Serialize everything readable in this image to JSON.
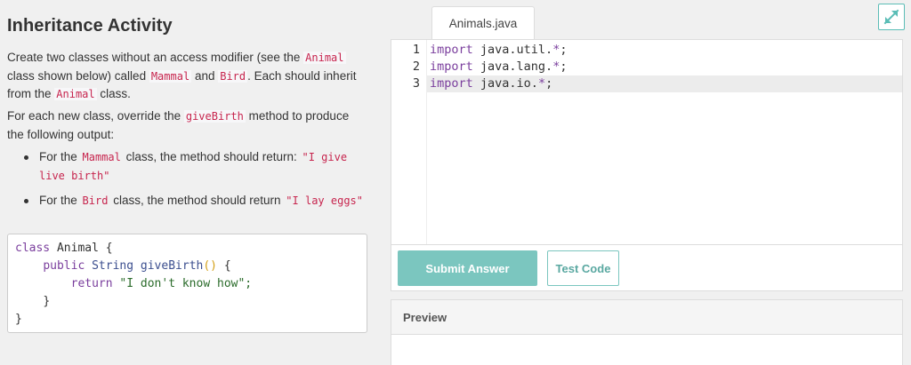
{
  "activity": {
    "title": "Inheritance Activity",
    "p1": [
      "Create two classes without an access modifier (see the ",
      "Animal",
      " class shown below) called ",
      "Mammal",
      " and ",
      "Bird",
      ". Each should inherit from the ",
      "Animal",
      " class."
    ],
    "p2": [
      "For each new class, override the ",
      "giveBirth",
      " method to produce the following output:"
    ],
    "bullets": [
      [
        "For the ",
        "Mammal",
        " class, the method should return: ",
        "\"I give live birth\""
      ],
      [
        "For the ",
        "Bird",
        " class, the method should return ",
        "\"I lay eggs\""
      ]
    ],
    "sample_code": {
      "l1_kw": "class",
      "l1_name": " Animal {",
      "l2_kw": "public",
      "l2_type": " String ",
      "l2_fn": "giveBirth",
      "l2_paren": "()",
      "l2_end": " {",
      "l3_kw": "return",
      "l3_str": " \"I don't know how\";",
      "l4": "}",
      "l5": "}"
    }
  },
  "editor": {
    "file_tab": "Animals.java",
    "lines": [
      {
        "num": "1",
        "kw": "import",
        "path": " java.util.",
        "star": "*",
        "end": ";"
      },
      {
        "num": "2",
        "kw": "import",
        "path": " java.lang.",
        "star": "*",
        "end": ";"
      },
      {
        "num": "3",
        "kw": "import",
        "path": " java.io.",
        "star": "*",
        "end": ";"
      }
    ],
    "submit_label": "Submit Answer",
    "test_label": "Test Code"
  },
  "preview": {
    "title": "Preview"
  },
  "colors": {
    "accent": "#7bc6bf",
    "keyword": "#7a3e9d",
    "inline_code": "#c7254e"
  }
}
